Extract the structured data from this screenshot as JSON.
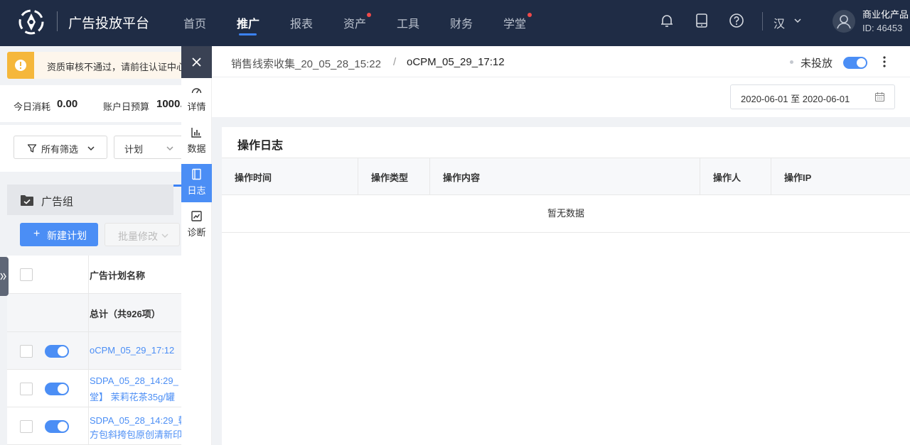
{
  "brand": "广告投放平台",
  "nav": [
    {
      "label": "首页",
      "active": false,
      "dot": false
    },
    {
      "label": "推广",
      "active": true,
      "dot": false
    },
    {
      "label": "报表",
      "active": false,
      "dot": false
    },
    {
      "label": "资产",
      "active": false,
      "dot": true
    },
    {
      "label": "工具",
      "active": false,
      "dot": false
    },
    {
      "label": "财务",
      "active": false,
      "dot": false
    },
    {
      "label": "学堂",
      "active": false,
      "dot": true
    }
  ],
  "header_icons": [
    "bell-icon",
    "tablet-icon",
    "help-icon"
  ],
  "language": "汉",
  "account": {
    "name": "商业化产品",
    "id": "ID: 46453"
  },
  "alert_text": "资质审核不通过，请前往认证中心",
  "stats": {
    "today_spend_label": "今日消耗",
    "today_spend_value": "0.00",
    "daily_budget_label": "账户日预算",
    "daily_budget_value": "1000."
  },
  "filters": {
    "all_filters": "所有筛选",
    "plan": "计划"
  },
  "ad_group_label": "广告组",
  "buttons": {
    "new_plan": "新建计划",
    "batch_edit": "批量修改"
  },
  "plan_table": {
    "header": "广告计划名称",
    "total": "总计（共926项）",
    "rows": [
      {
        "line1": "oCPM_05_29_17:12",
        "line2": ""
      },
      {
        "line1": "SDPA_05_28_14:29_",
        "line2": "堂】 茉莉花茶35g/罐"
      },
      {
        "line1": "SDPA_05_28_14:29_韩",
        "line2": "方包斜挎包原创清新印"
      }
    ]
  },
  "side_tabs": [
    {
      "label": "详情",
      "icon": "gauge-icon",
      "active": false
    },
    {
      "label": "数据",
      "icon": "bar-chart-icon",
      "active": false
    },
    {
      "label": "日志",
      "icon": "document-icon",
      "active": true
    },
    {
      "label": "诊断",
      "icon": "trend-chart-icon",
      "active": false
    }
  ],
  "drawer": {
    "breadcrumb_parent": "销售线索收集_20_05_28_15:22",
    "breadcrumb_sep": "/",
    "breadcrumb_current": "oCPM_05_29_17:12",
    "status": "未投放",
    "date_range": "2020-06-01 至 2020-06-01",
    "log_title": "操作日志",
    "columns": [
      "操作时间",
      "操作类型",
      "操作内容",
      "操作人",
      "操作IP"
    ],
    "empty_text": "暂无数据"
  }
}
